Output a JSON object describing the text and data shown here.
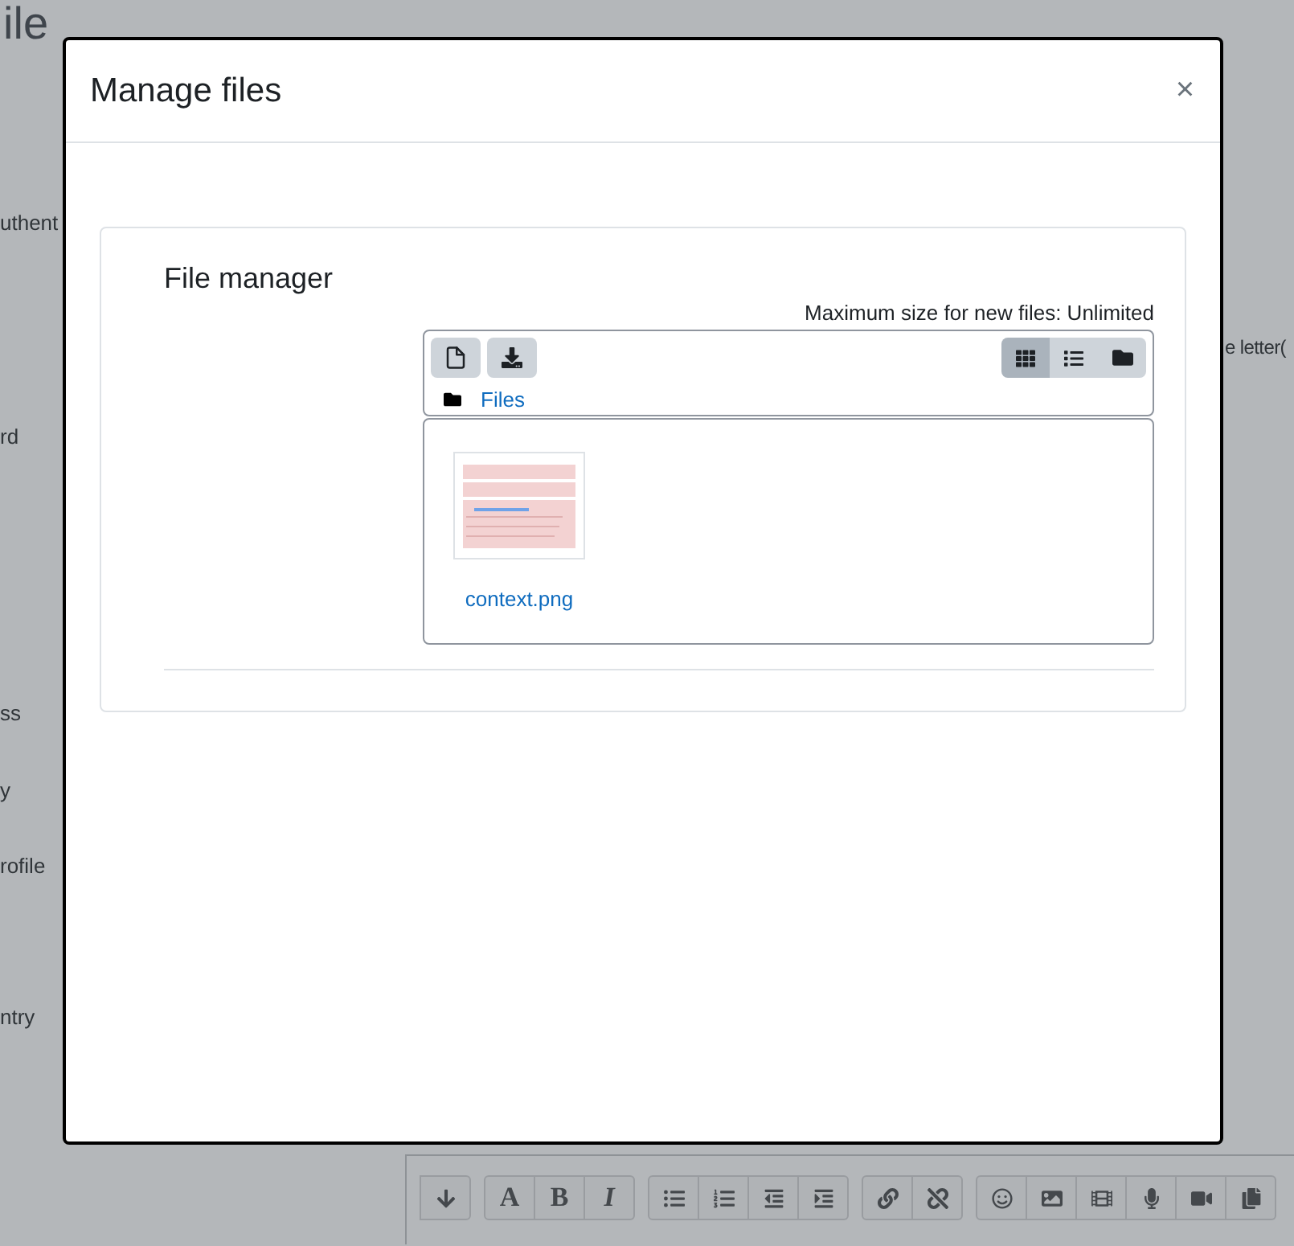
{
  "background_page": {
    "heading": "ile",
    "labels": [
      "uthent",
      "rd",
      "ss",
      "y",
      "rofile",
      "ntry"
    ],
    "side_label": "e letter(",
    "editor_toolbar_letters": [
      "A",
      "B",
      "I"
    ]
  },
  "dialog": {
    "title": "Manage files",
    "close": "×",
    "file_manager": {
      "title": "File manager",
      "max_size": "Maximum size for new files: Unlimited",
      "path": "Files",
      "view_modes": [
        {
          "kind": "icons",
          "selected": true
        },
        {
          "kind": "list",
          "selected": false
        },
        {
          "kind": "tree",
          "selected": false
        }
      ],
      "files": [
        {
          "name": "context.png"
        }
      ]
    }
  }
}
